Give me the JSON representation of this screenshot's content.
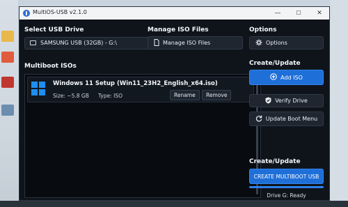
{
  "window": {
    "title": "MultiOS-USB v2.1.0",
    "minimize": "—",
    "maximize": "☐",
    "close": "✕"
  },
  "usb": {
    "label": "Select USB Drive",
    "selected": "SAMSUNG USB (32GB) - G:\\"
  },
  "manage": {
    "label": "Manage ISO Files",
    "button": "Manage ISO Files"
  },
  "options": {
    "label": "Options",
    "button": "Options"
  },
  "isos": {
    "label": "Multiboot ISOs",
    "items": [
      {
        "name": "Windows 11 Setup (Win11_23H2_English_x64.iso)",
        "size": "Size: ~5.8 GB",
        "type": "Type: ISO",
        "rename": "Rename",
        "remove": "Remove"
      }
    ]
  },
  "create_update": {
    "label": "Create/Update",
    "add_iso": "Add ISO",
    "verify": "Verify Drive",
    "update_boot": "Update Boot Menu"
  },
  "create_update_2": {
    "label": "Create/Update",
    "create_button": "CREATE MULTIBOOT USB",
    "progress": 1.0,
    "status": "Drive G: Ready"
  },
  "colors": {
    "accent": "#1f6fd8",
    "window_bg": "#0f141b"
  }
}
